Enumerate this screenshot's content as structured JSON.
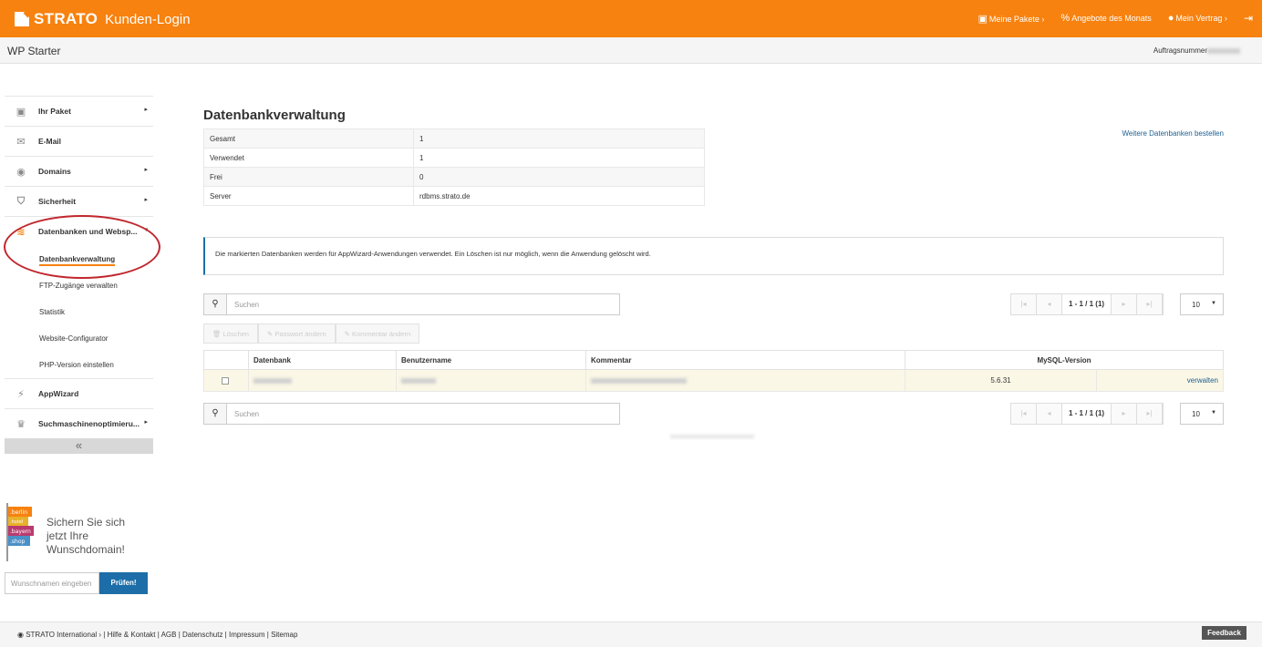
{
  "header": {
    "brand": "STRATO",
    "title": "Kunden-Login",
    "nav": [
      {
        "icon": "package-icon",
        "glyph": "▣",
        "label": "Meine Pakete ›"
      },
      {
        "icon": "percent-icon",
        "glyph": "%",
        "label": "Angebote des Monats"
      },
      {
        "icon": "user-icon",
        "glyph": "●",
        "label": "Mein Vertrag ›"
      }
    ],
    "logout_glyph": "⇥"
  },
  "subheader": {
    "product": "WP Starter",
    "order_label": "Auftragsnummer"
  },
  "sidebar": {
    "items": [
      {
        "name": "ihr-paket",
        "icon": "package-icon",
        "glyph": "▣",
        "label": "Ihr Paket",
        "arrow": "▸"
      },
      {
        "name": "email",
        "icon": "mail-icon",
        "glyph": "✉",
        "label": "E-Mail",
        "arrow": ""
      },
      {
        "name": "domains",
        "icon": "globe-icon",
        "glyph": "◉",
        "label": "Domains",
        "arrow": "▸"
      },
      {
        "name": "sicherheit",
        "icon": "shield-icon",
        "glyph": "⛉",
        "label": "Sicherheit",
        "arrow": "▸"
      },
      {
        "name": "datenbanken",
        "icon": "database-icon",
        "glyph": "≋",
        "label": "Datenbanken und Websp...",
        "arrow": "▾"
      }
    ],
    "subitems": [
      {
        "name": "datenbankverwaltung",
        "label": "Datenbankverwaltung",
        "active": true
      },
      {
        "name": "ftp",
        "label": "FTP-Zugänge verwalten",
        "active": false
      },
      {
        "name": "statistik",
        "label": "Statistik",
        "active": false
      },
      {
        "name": "website-configurator",
        "label": "Website-Configurator",
        "active": false
      },
      {
        "name": "php-version",
        "label": "PHP-Version einstellen",
        "active": false
      }
    ],
    "items2": [
      {
        "name": "appwizard",
        "icon": "wand-icon",
        "glyph": "⚡",
        "label": "AppWizard",
        "arrow": ""
      },
      {
        "name": "seo",
        "icon": "trophy-icon",
        "glyph": "♛",
        "label": "Suchmaschinenoptimieru...",
        "arrow": "▸"
      }
    ],
    "collapse_glyph": "«"
  },
  "promo": {
    "text_line1": "Sichern Sie sich",
    "text_line2": "jetzt Ihre",
    "text_line3": "Wunschdomain!",
    "flag_labels": [
      ".berlin",
      ".hotel",
      ".bayern",
      ".shop"
    ],
    "input_placeholder": "Wunschnamen eingeben",
    "button": "Prüfen!"
  },
  "main": {
    "title": "Datenbankverwaltung",
    "more_link": "Weitere Datenbanken bestellen",
    "stats": [
      {
        "label": "Gesamt",
        "value": "1"
      },
      {
        "label": "Verwendet",
        "value": "1"
      },
      {
        "label": "Frei",
        "value": "0"
      },
      {
        "label": "Server",
        "value": "rdbms.strato.de"
      }
    ],
    "info": "Die markierten Datenbanken werden für AppWizard-Anwendungen verwendet. Ein Löschen ist nur möglich, wenn die Anwendung gelöscht wird.",
    "search_placeholder": "Suchen",
    "pager": {
      "first": "|◂",
      "prev": "◂",
      "current": "1 - 1 / 1 (1)",
      "next": "▸",
      "last": "▸|"
    },
    "per_page": "10",
    "actions": [
      "🗑 Löschen",
      "✎ Passwort ändern",
      "✎ Kommentar ändern"
    ],
    "table": {
      "headers": [
        "Datenbank",
        "Benutzername",
        "Kommentar",
        "MySQL-Version"
      ],
      "rows": [
        {
          "version": "5.6.31",
          "action": "verwalten"
        }
      ]
    }
  },
  "footer": {
    "links": "◉ STRATO International ›  |  Hilfe & Kontakt  |  AGB  |  Datenschutz  |  Impressum  |  Sitemap",
    "feedback": "Feedback"
  }
}
